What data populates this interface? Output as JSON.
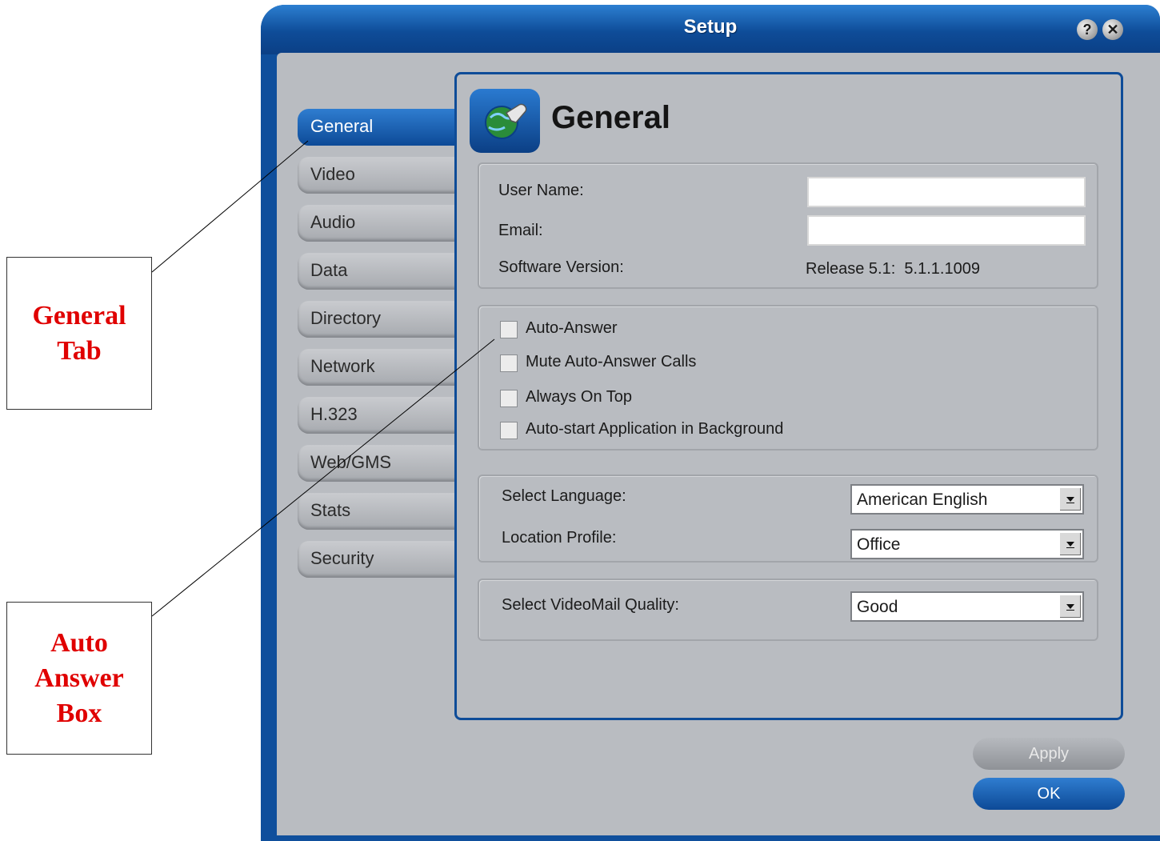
{
  "callouts": {
    "general_tab": [
      "General",
      "Tab"
    ],
    "auto_answer_box": [
      "Auto",
      "Answer",
      "Box"
    ]
  },
  "window": {
    "title": "Setup",
    "help_glyph": "?",
    "close_glyph": "✕"
  },
  "tabs": [
    {
      "label": "General",
      "active": true
    },
    {
      "label": "Video"
    },
    {
      "label": "Audio"
    },
    {
      "label": "Data"
    },
    {
      "label": "Directory"
    },
    {
      "label": "Network"
    },
    {
      "label": "H.323"
    },
    {
      "label": "Web/GMS"
    },
    {
      "label": "Stats"
    },
    {
      "label": "Security"
    }
  ],
  "panel": {
    "heading": "General",
    "icon": "globe-wrench-icon",
    "user_name_label": "User Name:",
    "user_name_value": "",
    "email_label": "Email:",
    "email_value": "",
    "software_version_label": "Software Version:",
    "software_version_value": "Release 5.1:  5.1.1.1009",
    "checkboxes": [
      {
        "label": "Auto-Answer",
        "checked": false
      },
      {
        "label": "Mute Auto-Answer Calls",
        "checked": false
      },
      {
        "label": "Always On Top",
        "checked": false
      },
      {
        "label": "Auto-start Application in Background",
        "checked": false
      }
    ],
    "language_label": "Select Language:",
    "language_value": "American English",
    "location_label": "Location Profile:",
    "location_value": "Office",
    "videomail_label": "Select VideoMail Quality:",
    "videomail_value": "Good"
  },
  "buttons": {
    "apply": "Apply",
    "ok": "OK"
  },
  "colors": {
    "frame_blue": "#0e4c98",
    "client_gray": "#b9bcc1",
    "callout_red": "#e00000"
  }
}
